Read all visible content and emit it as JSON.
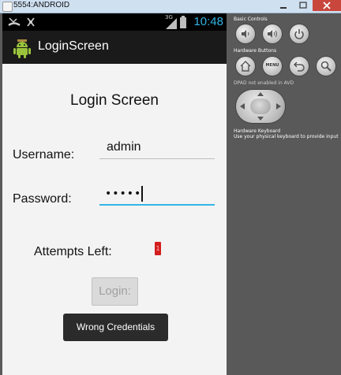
{
  "window": {
    "title": "5554:ANDROID"
  },
  "statusbar": {
    "network": "3G",
    "time": "10:48"
  },
  "app": {
    "title": "LoginScreen"
  },
  "form": {
    "heading": "Login Screen",
    "username_label": "Username:",
    "username_value": "admin",
    "password_label": "Password:",
    "password_mask": "•••••",
    "attempts_label": "Attempts Left:",
    "attempts_value": "1",
    "login_button": "Login:"
  },
  "toast": {
    "text": "Wrong Credentials"
  },
  "controls": {
    "basic_controls_label": "Basic Controls",
    "hardware_buttons_label": "Hardware Buttons",
    "menu_button": "MENU",
    "dpad_label": "DPAD not enabled in AVD",
    "hardware_keyboard_label": "Hardware Keyboard",
    "keyboard_hint": "Use your physical keyboard to provide input"
  },
  "colors": {
    "accent": "#33b5e5",
    "attempts_badge": "#d41e1e",
    "toast_bg": "#2b2b2b"
  }
}
